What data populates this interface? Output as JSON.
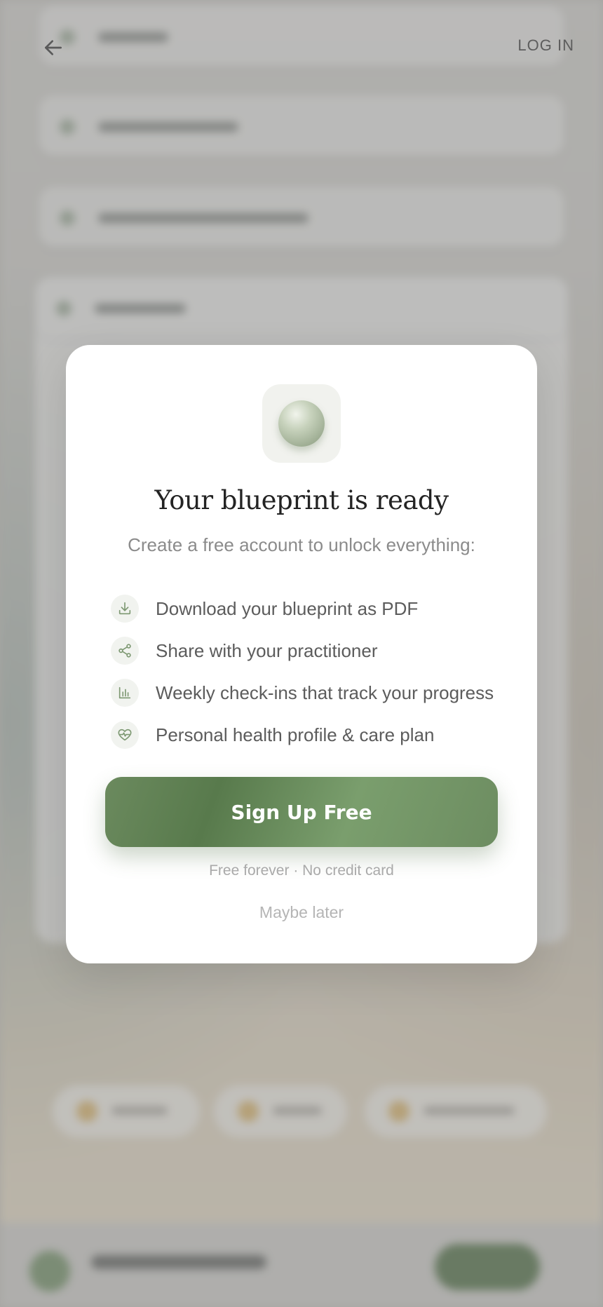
{
  "nav": {
    "login_label": "LOG IN"
  },
  "modal": {
    "title": "Your blueprint is ready",
    "subtitle": "Create a free account to unlock everything:",
    "features": [
      {
        "icon": "download-icon",
        "label": "Download your blueprint as PDF"
      },
      {
        "icon": "share-icon",
        "label": "Share with your practitioner"
      },
      {
        "icon": "bar-chart-icon",
        "label": "Weekly check-ins that track your progress"
      },
      {
        "icon": "heart-pulse-icon",
        "label": "Personal health profile & care plan"
      }
    ],
    "signup_label": "Sign Up Free",
    "fine_print": "Free forever · No credit card",
    "maybe_later_label": "Maybe later"
  },
  "colors": {
    "accent_green": "#6b8a5e",
    "icon_green": "#7d9872",
    "title_text": "#232323",
    "muted_text": "#8b8b8b"
  }
}
